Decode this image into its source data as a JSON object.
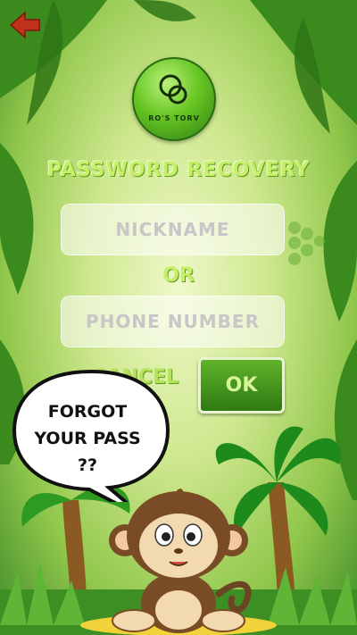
{
  "header": {
    "back_icon": "arrow-left-icon",
    "back_color": "#c0301a"
  },
  "logo": {
    "text": "RO'S TORV"
  },
  "title": "PASSWORD RECOVERY",
  "form": {
    "nickname_placeholder": "NICKNAME",
    "or_label": "OR",
    "phone_placeholder": "PHONE NUMBER",
    "cancel_label": "CANCEL",
    "ok_label": "OK"
  },
  "bubble": {
    "line1": "FORGOT",
    "line2": "YOUR PASS",
    "line3": "??"
  },
  "colors": {
    "accent": "#4a9e1e",
    "title": "#c6ef69"
  }
}
